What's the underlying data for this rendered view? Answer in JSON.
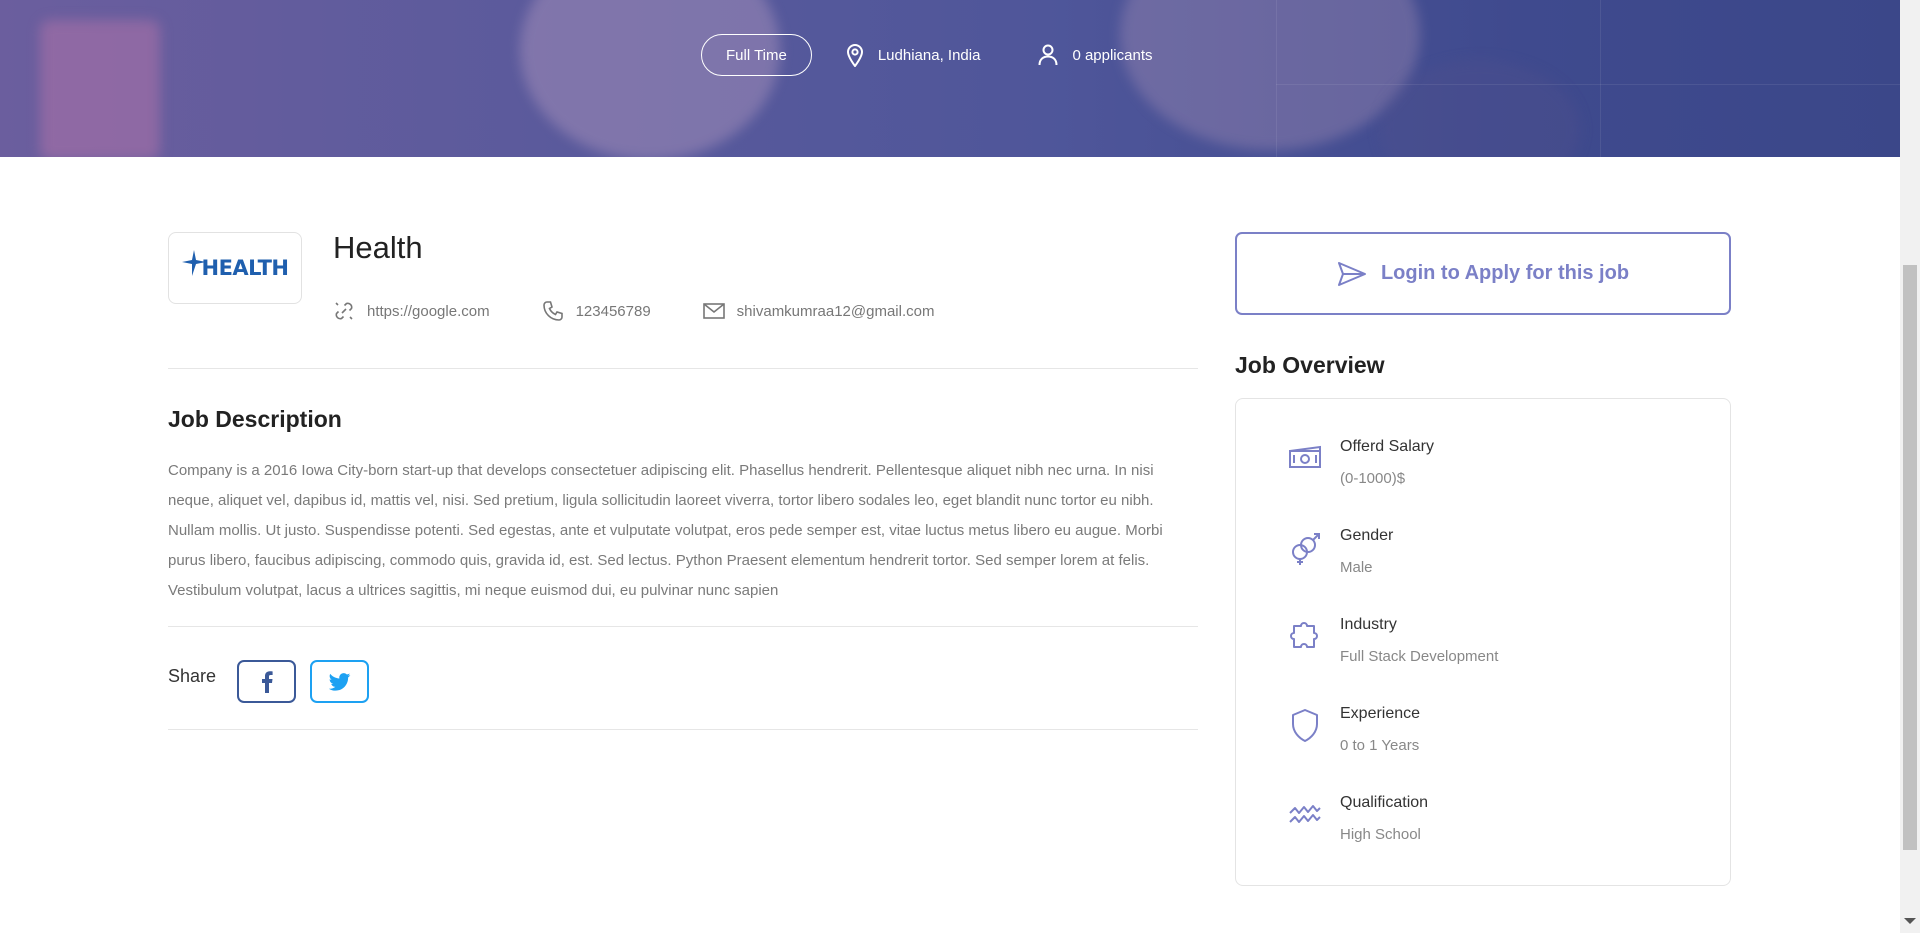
{
  "hero": {
    "job_type": "Full Time",
    "location": "Ludhiana, India",
    "applicants": "0 applicants"
  },
  "company": {
    "logo_text": "HEALTH",
    "name": "Health",
    "website": "https://google.com",
    "phone": "123456789",
    "email": "shivamkumraa12@gmail.com"
  },
  "description": {
    "title": "Job Description",
    "text": "Company is a 2016 Iowa City-born start-up that develops consectetuer adipiscing elit. Phasellus hendrerit. Pellentesque aliquet nibh nec urna. In nisi neque, aliquet vel, dapibus id, mattis vel, nisi. Sed pretium, ligula sollicitudin laoreet viverra, tortor libero sodales leo, eget blandit nunc tortor eu nibh. Nullam mollis. Ut justo. Suspendisse potenti. Sed egestas, ante et vulputate volutpat, eros pede semper est, vitae luctus metus libero eu augue. Morbi purus libero, faucibus adipiscing, commodo quis, gravida id, est. Sed lectus. Python Praesent elementum hendrerit tortor. Sed semper lorem at felis. Vestibulum volutpat, lacus a ultrices sagittis, mi neque euismod dui, eu pulvinar nunc sapien"
  },
  "share": {
    "label": "Share"
  },
  "apply": {
    "label": "Login to Apply for this job"
  },
  "overview": {
    "title": "Job Overview",
    "items": [
      {
        "label": "Offerd Salary",
        "value": "(0-1000)$",
        "icon": "money-icon"
      },
      {
        "label": "Gender",
        "value": "Male",
        "icon": "gender-icon"
      },
      {
        "label": "Industry",
        "value": "Full Stack Development",
        "icon": "puzzle-icon"
      },
      {
        "label": "Experience",
        "value": "0 to 1 Years",
        "icon": "shield-icon"
      },
      {
        "label": "Qualification",
        "value": "High School",
        "icon": "wave-icon"
      }
    ]
  },
  "colors": {
    "accent": "#7b80c7",
    "facebook": "#3b5998",
    "twitter": "#1da1f2"
  }
}
